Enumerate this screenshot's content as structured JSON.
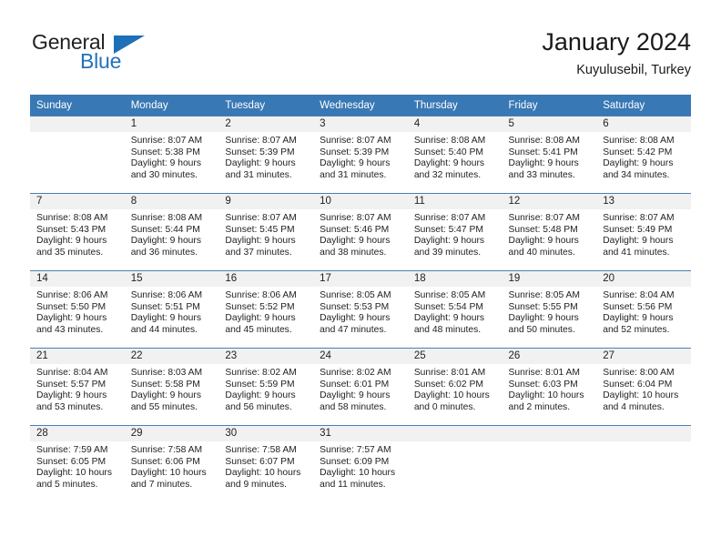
{
  "brand": {
    "name_part1": "General",
    "name_part2": "Blue",
    "logo_icon": "triangle-icon"
  },
  "header": {
    "title": "January 2024",
    "subtitle": "Kuyulusebil, Turkey"
  },
  "colors": {
    "header_blue": "#3878b4",
    "brand_blue": "#2272ba",
    "daynum_band": "#f1f1f1",
    "grid_line": "#4a7fb5",
    "text": "#222222"
  },
  "calendar": {
    "weekday_headers": [
      "Sunday",
      "Monday",
      "Tuesday",
      "Wednesday",
      "Thursday",
      "Friday",
      "Saturday"
    ],
    "labels": {
      "sunrise": "Sunrise:",
      "sunset": "Sunset:",
      "daylight": "Daylight:"
    },
    "weeks": [
      [
        {
          "day": "",
          "empty": true,
          "lines": [
            "",
            "",
            "",
            ""
          ]
        },
        {
          "day": "1",
          "empty": false,
          "lines": [
            "Sunrise: 8:07 AM",
            "Sunset: 5:38 PM",
            "Daylight: 9 hours",
            "and 30 minutes."
          ]
        },
        {
          "day": "2",
          "empty": false,
          "lines": [
            "Sunrise: 8:07 AM",
            "Sunset: 5:39 PM",
            "Daylight: 9 hours",
            "and 31 minutes."
          ]
        },
        {
          "day": "3",
          "empty": false,
          "lines": [
            "Sunrise: 8:07 AM",
            "Sunset: 5:39 PM",
            "Daylight: 9 hours",
            "and 31 minutes."
          ]
        },
        {
          "day": "4",
          "empty": false,
          "lines": [
            "Sunrise: 8:08 AM",
            "Sunset: 5:40 PM",
            "Daylight: 9 hours",
            "and 32 minutes."
          ]
        },
        {
          "day": "5",
          "empty": false,
          "lines": [
            "Sunrise: 8:08 AM",
            "Sunset: 5:41 PM",
            "Daylight: 9 hours",
            "and 33 minutes."
          ]
        },
        {
          "day": "6",
          "empty": false,
          "lines": [
            "Sunrise: 8:08 AM",
            "Sunset: 5:42 PM",
            "Daylight: 9 hours",
            "and 34 minutes."
          ]
        }
      ],
      [
        {
          "day": "7",
          "empty": false,
          "lines": [
            "Sunrise: 8:08 AM",
            "Sunset: 5:43 PM",
            "Daylight: 9 hours",
            "and 35 minutes."
          ]
        },
        {
          "day": "8",
          "empty": false,
          "lines": [
            "Sunrise: 8:08 AM",
            "Sunset: 5:44 PM",
            "Daylight: 9 hours",
            "and 36 minutes."
          ]
        },
        {
          "day": "9",
          "empty": false,
          "lines": [
            "Sunrise: 8:07 AM",
            "Sunset: 5:45 PM",
            "Daylight: 9 hours",
            "and 37 minutes."
          ]
        },
        {
          "day": "10",
          "empty": false,
          "lines": [
            "Sunrise: 8:07 AM",
            "Sunset: 5:46 PM",
            "Daylight: 9 hours",
            "and 38 minutes."
          ]
        },
        {
          "day": "11",
          "empty": false,
          "lines": [
            "Sunrise: 8:07 AM",
            "Sunset: 5:47 PM",
            "Daylight: 9 hours",
            "and 39 minutes."
          ]
        },
        {
          "day": "12",
          "empty": false,
          "lines": [
            "Sunrise: 8:07 AM",
            "Sunset: 5:48 PM",
            "Daylight: 9 hours",
            "and 40 minutes."
          ]
        },
        {
          "day": "13",
          "empty": false,
          "lines": [
            "Sunrise: 8:07 AM",
            "Sunset: 5:49 PM",
            "Daylight: 9 hours",
            "and 41 minutes."
          ]
        }
      ],
      [
        {
          "day": "14",
          "empty": false,
          "lines": [
            "Sunrise: 8:06 AM",
            "Sunset: 5:50 PM",
            "Daylight: 9 hours",
            "and 43 minutes."
          ]
        },
        {
          "day": "15",
          "empty": false,
          "lines": [
            "Sunrise: 8:06 AM",
            "Sunset: 5:51 PM",
            "Daylight: 9 hours",
            "and 44 minutes."
          ]
        },
        {
          "day": "16",
          "empty": false,
          "lines": [
            "Sunrise: 8:06 AM",
            "Sunset: 5:52 PM",
            "Daylight: 9 hours",
            "and 45 minutes."
          ]
        },
        {
          "day": "17",
          "empty": false,
          "lines": [
            "Sunrise: 8:05 AM",
            "Sunset: 5:53 PM",
            "Daylight: 9 hours",
            "and 47 minutes."
          ]
        },
        {
          "day": "18",
          "empty": false,
          "lines": [
            "Sunrise: 8:05 AM",
            "Sunset: 5:54 PM",
            "Daylight: 9 hours",
            "and 48 minutes."
          ]
        },
        {
          "day": "19",
          "empty": false,
          "lines": [
            "Sunrise: 8:05 AM",
            "Sunset: 5:55 PM",
            "Daylight: 9 hours",
            "and 50 minutes."
          ]
        },
        {
          "day": "20",
          "empty": false,
          "lines": [
            "Sunrise: 8:04 AM",
            "Sunset: 5:56 PM",
            "Daylight: 9 hours",
            "and 52 minutes."
          ]
        }
      ],
      [
        {
          "day": "21",
          "empty": false,
          "lines": [
            "Sunrise: 8:04 AM",
            "Sunset: 5:57 PM",
            "Daylight: 9 hours",
            "and 53 minutes."
          ]
        },
        {
          "day": "22",
          "empty": false,
          "lines": [
            "Sunrise: 8:03 AM",
            "Sunset: 5:58 PM",
            "Daylight: 9 hours",
            "and 55 minutes."
          ]
        },
        {
          "day": "23",
          "empty": false,
          "lines": [
            "Sunrise: 8:02 AM",
            "Sunset: 5:59 PM",
            "Daylight: 9 hours",
            "and 56 minutes."
          ]
        },
        {
          "day": "24",
          "empty": false,
          "lines": [
            "Sunrise: 8:02 AM",
            "Sunset: 6:01 PM",
            "Daylight: 9 hours",
            "and 58 minutes."
          ]
        },
        {
          "day": "25",
          "empty": false,
          "lines": [
            "Sunrise: 8:01 AM",
            "Sunset: 6:02 PM",
            "Daylight: 10 hours",
            "and 0 minutes."
          ]
        },
        {
          "day": "26",
          "empty": false,
          "lines": [
            "Sunrise: 8:01 AM",
            "Sunset: 6:03 PM",
            "Daylight: 10 hours",
            "and 2 minutes."
          ]
        },
        {
          "day": "27",
          "empty": false,
          "lines": [
            "Sunrise: 8:00 AM",
            "Sunset: 6:04 PM",
            "Daylight: 10 hours",
            "and 4 minutes."
          ]
        }
      ],
      [
        {
          "day": "28",
          "empty": false,
          "lines": [
            "Sunrise: 7:59 AM",
            "Sunset: 6:05 PM",
            "Daylight: 10 hours",
            "and 5 minutes."
          ]
        },
        {
          "day": "29",
          "empty": false,
          "lines": [
            "Sunrise: 7:58 AM",
            "Sunset: 6:06 PM",
            "Daylight: 10 hours",
            "and 7 minutes."
          ]
        },
        {
          "day": "30",
          "empty": false,
          "lines": [
            "Sunrise: 7:58 AM",
            "Sunset: 6:07 PM",
            "Daylight: 10 hours",
            "and 9 minutes."
          ]
        },
        {
          "day": "31",
          "empty": false,
          "lines": [
            "Sunrise: 7:57 AM",
            "Sunset: 6:09 PM",
            "Daylight: 10 hours",
            "and 11 minutes."
          ]
        },
        {
          "day": "",
          "empty": true,
          "lines": [
            "",
            "",
            "",
            ""
          ]
        },
        {
          "day": "",
          "empty": true,
          "lines": [
            "",
            "",
            "",
            ""
          ]
        },
        {
          "day": "",
          "empty": true,
          "lines": [
            "",
            "",
            "",
            ""
          ]
        }
      ]
    ]
  }
}
